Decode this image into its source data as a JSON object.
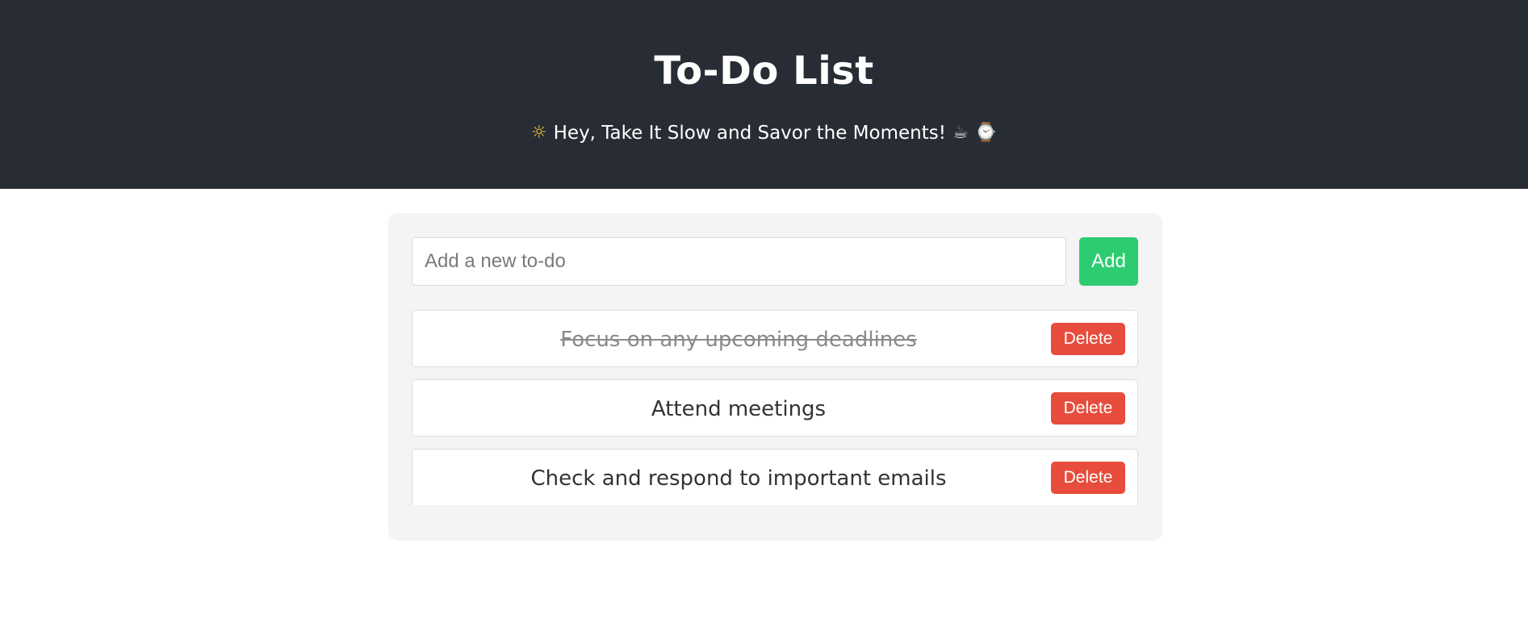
{
  "header": {
    "title": "To-Do List",
    "subtitle": "Hey, Take It Slow and Savor the Moments!",
    "icons": {
      "leading": "sun-face-icon",
      "trailing_1": "hot-beverage-icon",
      "trailing_2": "mantelpiece-clock-icon"
    }
  },
  "colors": {
    "header_bg": "#282c34",
    "add_button": "#2ecc71",
    "delete_button": "#e74c3c",
    "card_bg": "#f4f4f4"
  },
  "input": {
    "placeholder": "Add a new to-do",
    "value": ""
  },
  "add_button": {
    "label": "Add"
  },
  "todos": [
    {
      "text": "Focus on any upcoming deadlines",
      "completed": true,
      "delete_label": "Delete"
    },
    {
      "text": "Attend meetings",
      "completed": false,
      "delete_label": "Delete"
    },
    {
      "text": "Check and respond to important emails",
      "completed": false,
      "delete_label": "Delete"
    }
  ]
}
